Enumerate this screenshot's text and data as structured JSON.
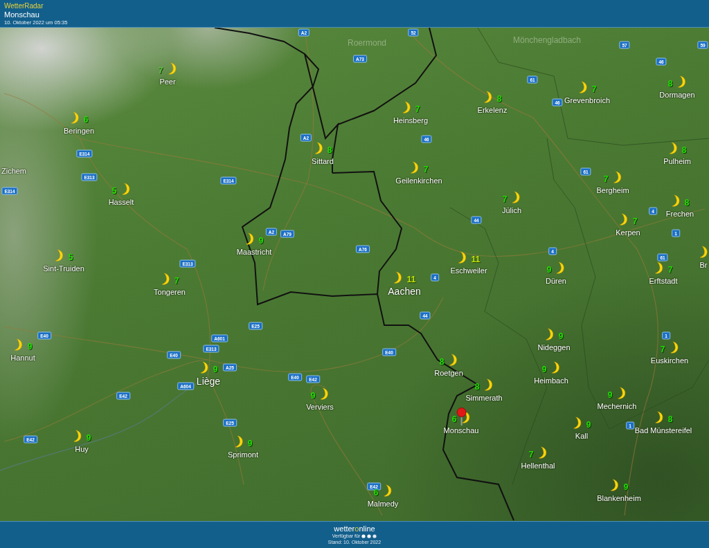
{
  "header": {
    "app_title": "WetterRadar",
    "location": "Monschau",
    "timestamp": "10. Oktober 2022 um 05:35"
  },
  "map": {
    "cities": [
      {
        "name": "Roermond",
        "kind": "faint",
        "selected": false
      },
      {
        "name": "Mönchengladbach",
        "kind": "faint",
        "selected": false
      },
      {
        "name": "Peer",
        "kind": "town",
        "temperature": "7",
        "color": "#5cc43a",
        "selected": false
      },
      {
        "name": "Beringen",
        "kind": "town",
        "temperature": "6",
        "color": "#22dd00",
        "selected": false
      },
      {
        "name": "Zichem",
        "kind": "label",
        "selected": false
      },
      {
        "name": "Hasselt",
        "kind": "town",
        "temperature": "5",
        "color": "#22dd00",
        "selected": false
      },
      {
        "name": "Sint-Truiden",
        "kind": "town",
        "temperature": "5",
        "color": "#22dd00",
        "selected": false
      },
      {
        "name": "Tongeren",
        "kind": "town",
        "temperature": "7",
        "color": "#22dd00",
        "selected": false
      },
      {
        "name": "Hannut",
        "kind": "town",
        "temperature": "9",
        "color": "#22dd00",
        "selected": false
      },
      {
        "name": "Liège",
        "kind": "city",
        "temperature": "9",
        "color": "#22dd00",
        "selected": false
      },
      {
        "name": "Huy",
        "kind": "town",
        "temperature": "9",
        "color": "#22dd00",
        "selected": false
      },
      {
        "name": "Sprimont",
        "kind": "town",
        "temperature": "9",
        "color": "#22dd00",
        "selected": false
      },
      {
        "name": "Verviers",
        "kind": "town",
        "temperature": "9",
        "color": "#22dd00",
        "selected": false
      },
      {
        "name": "Maastricht",
        "kind": "town",
        "temperature": "9",
        "color": "#22dd00",
        "selected": false
      },
      {
        "name": "Sittard",
        "kind": "town",
        "temperature": "8",
        "color": "#22dd00",
        "selected": false
      },
      {
        "name": "Heinsberg",
        "kind": "town",
        "temperature": "7",
        "color": "#22dd00",
        "selected": false
      },
      {
        "name": "Geilenkirchen",
        "kind": "town",
        "temperature": "7",
        "color": "#22dd00",
        "selected": false
      },
      {
        "name": "Erkelenz",
        "kind": "town",
        "temperature": "8",
        "color": "#22dd00",
        "selected": false
      },
      {
        "name": "Grevenbroich",
        "kind": "town",
        "temperature": "7",
        "color": "#22dd00",
        "selected": false
      },
      {
        "name": "Dormagen",
        "kind": "town",
        "temperature": "8",
        "color": "#22dd00",
        "selected": false
      },
      {
        "name": "Pulheim",
        "kind": "town",
        "temperature": "8",
        "color": "#22dd00",
        "selected": false
      },
      {
        "name": "Bergheim",
        "kind": "town",
        "temperature": "7",
        "color": "#22dd00",
        "selected": false
      },
      {
        "name": "Jülich",
        "kind": "town",
        "temperature": "7",
        "color": "#22dd00",
        "selected": false
      },
      {
        "name": "Frechen",
        "kind": "town",
        "temperature": "8",
        "color": "#22dd00",
        "selected": false
      },
      {
        "name": "Kerpen",
        "kind": "town",
        "temperature": "7",
        "color": "#22dd00",
        "selected": false
      },
      {
        "name": "Eschweiler",
        "kind": "town",
        "temperature": "11",
        "color": "#c8e400",
        "selected": false
      },
      {
        "name": "Aachen",
        "kind": "city",
        "temperature": "11",
        "color": "#c8e400",
        "selected": false
      },
      {
        "name": "Düren",
        "kind": "town",
        "temperature": "9",
        "color": "#22dd00",
        "selected": false
      },
      {
        "name": "Erftstadt",
        "kind": "town",
        "temperature": "7",
        "color": "#22dd00",
        "selected": false
      },
      {
        "name": "Br",
        "kind": "town",
        "selected": false
      },
      {
        "name": "Nideggen",
        "kind": "town",
        "temperature": "9",
        "color": "#22dd00",
        "selected": false
      },
      {
        "name": "Heimbach",
        "kind": "town",
        "temperature": "9",
        "color": "#22dd00",
        "selected": false
      },
      {
        "name": "Euskirchen",
        "kind": "town",
        "temperature": "7",
        "color": "#22dd00",
        "selected": false
      },
      {
        "name": "Roetgen",
        "kind": "town",
        "temperature": "8",
        "color": "#22dd00",
        "selected": false
      },
      {
        "name": "Simmerath",
        "kind": "town",
        "temperature": "8",
        "color": "#22dd00",
        "selected": false
      },
      {
        "name": "Monschau",
        "kind": "town",
        "temperature": "6",
        "color": "#22dd00",
        "selected": true
      },
      {
        "name": "Mechernich",
        "kind": "town",
        "temperature": "9",
        "color": "#22dd00",
        "selected": false
      },
      {
        "name": "Kall",
        "kind": "town",
        "temperature": "9",
        "color": "#22dd00",
        "selected": false
      },
      {
        "name": "Bad Münstereifel",
        "kind": "town",
        "temperature": "8",
        "color": "#22dd00",
        "selected": false
      },
      {
        "name": "Hellenthal",
        "kind": "town",
        "temperature": "7",
        "color": "#22dd00",
        "selected": false
      },
      {
        "name": "Blankenheim",
        "kind": "town",
        "temperature": "9",
        "color": "#22dd00",
        "selected": false
      },
      {
        "name": "Malmedy",
        "kind": "town",
        "temperature": "6",
        "color": "#22dd00",
        "selected": false
      }
    ],
    "roads": [
      "A2",
      "52",
      "A73",
      "61",
      "46",
      "57",
      "46",
      "59",
      "A2",
      "E314",
      "E313",
      "E314",
      "E314",
      "A2",
      "A79",
      "A76",
      "46",
      "44",
      "61",
      "4",
      "1",
      "61",
      "4",
      "4",
      "E313",
      "E25",
      "A601",
      "E313",
      "E40",
      "E40",
      "A25",
      "A604",
      "E42",
      "E40",
      "E42",
      "E40",
      "E42",
      "E25",
      "44",
      "E42",
      "1",
      "1"
    ]
  },
  "footer": {
    "logo": [
      {
        "text": "wetter",
        "accent": false
      },
      {
        "text": "o",
        "accent": true
      },
      {
        "text": "nline",
        "accent": false
      }
    ],
    "availability": "Verfügbar für",
    "updated": "Stand: 10. Oktober 2022"
  }
}
